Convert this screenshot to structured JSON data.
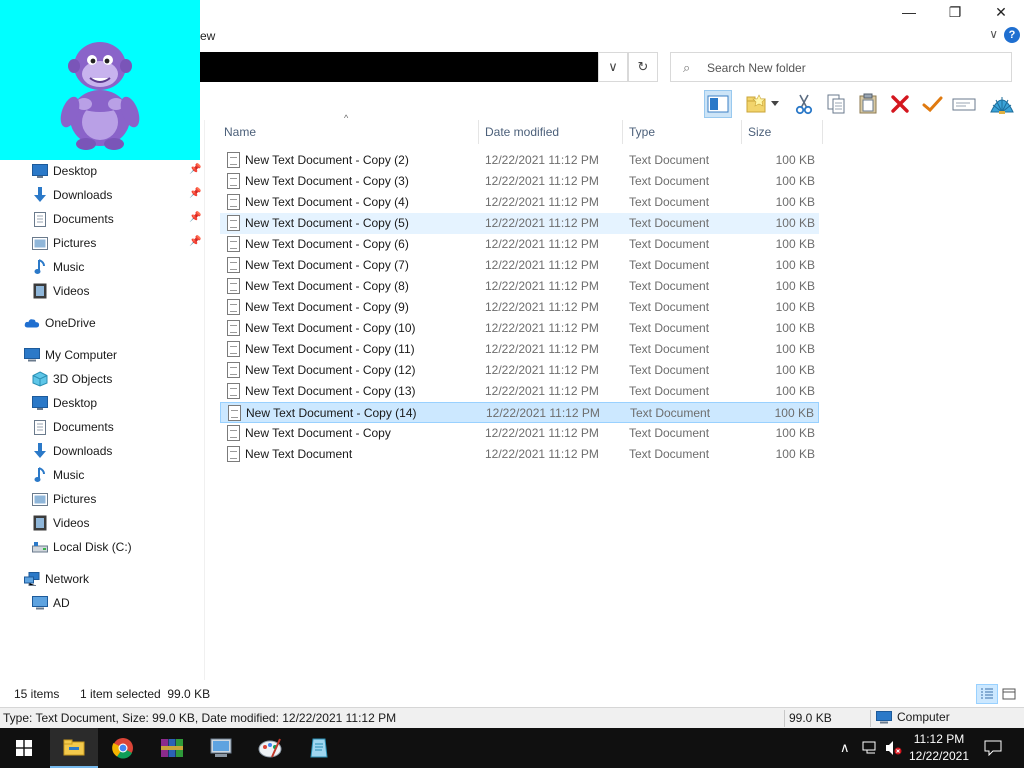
{
  "window": {
    "minimize_glyph": "—",
    "restore_glyph": "❐",
    "close_glyph": "✕",
    "ribbon_tab_partial": "ew",
    "help_glyph": "?",
    "ribbon_toggle_glyph": "∨"
  },
  "address": {
    "dropdown_glyph": "∨",
    "refresh_glyph": "↻"
  },
  "search": {
    "placeholder": "Search New folder",
    "icon": "search-icon"
  },
  "toolbar_icons": [
    "preview-pane-icon",
    "new-folder-icon",
    "dropdown-arrow-icon",
    "cut-icon",
    "copy-icon",
    "paste-icon",
    "delete-icon",
    "check-icon",
    "rename-icon",
    "shell-icon"
  ],
  "nav": {
    "quick_access": [
      {
        "label": "Desktop",
        "icon": "desktop-icon"
      },
      {
        "label": "Downloads",
        "icon": "downloads-icon"
      },
      {
        "label": "Documents",
        "icon": "documents-icon"
      },
      {
        "label": "Pictures",
        "icon": "pictures-icon"
      },
      {
        "label": "Music",
        "icon": "music-icon"
      },
      {
        "label": "Videos",
        "icon": "videos-icon"
      }
    ],
    "onedrive": "OneDrive",
    "computer": "My Computer",
    "computer_items": [
      {
        "label": "3D Objects",
        "icon": "3d-objects-icon"
      },
      {
        "label": "Desktop",
        "icon": "desktop-icon"
      },
      {
        "label": "Documents",
        "icon": "documents-icon"
      },
      {
        "label": "Downloads",
        "icon": "downloads-icon"
      },
      {
        "label": "Music",
        "icon": "music-icon"
      },
      {
        "label": "Pictures",
        "icon": "pictures-icon"
      },
      {
        "label": "Videos",
        "icon": "videos-icon"
      },
      {
        "label": "Local Disk (C:)",
        "icon": "local-disk-icon"
      }
    ],
    "network": "Network",
    "network_items": [
      {
        "label": "AD",
        "icon": "computer-icon"
      }
    ],
    "pin_glyph": "📌"
  },
  "columns": {
    "name": "Name",
    "date": "Date modified",
    "type": "Type",
    "size": "Size",
    "sort_glyph": "^"
  },
  "files": [
    {
      "name": "New Text Document - Copy (2)",
      "date": "12/22/2021 11:12 PM",
      "type": "Text Document",
      "size": "100 KB",
      "state": ""
    },
    {
      "name": "New Text Document - Copy (3)",
      "date": "12/22/2021 11:12 PM",
      "type": "Text Document",
      "size": "100 KB",
      "state": ""
    },
    {
      "name": "New Text Document - Copy (4)",
      "date": "12/22/2021 11:12 PM",
      "type": "Text Document",
      "size": "100 KB",
      "state": ""
    },
    {
      "name": "New Text Document - Copy (5)",
      "date": "12/22/2021 11:12 PM",
      "type": "Text Document",
      "size": "100 KB",
      "state": "hover"
    },
    {
      "name": "New Text Document - Copy (6)",
      "date": "12/22/2021 11:12 PM",
      "type": "Text Document",
      "size": "100 KB",
      "state": ""
    },
    {
      "name": "New Text Document - Copy (7)",
      "date": "12/22/2021 11:12 PM",
      "type": "Text Document",
      "size": "100 KB",
      "state": ""
    },
    {
      "name": "New Text Document - Copy (8)",
      "date": "12/22/2021 11:12 PM",
      "type": "Text Document",
      "size": "100 KB",
      "state": ""
    },
    {
      "name": "New Text Document - Copy (9)",
      "date": "12/22/2021 11:12 PM",
      "type": "Text Document",
      "size": "100 KB",
      "state": ""
    },
    {
      "name": "New Text Document - Copy (10)",
      "date": "12/22/2021 11:12 PM",
      "type": "Text Document",
      "size": "100 KB",
      "state": ""
    },
    {
      "name": "New Text Document - Copy (11)",
      "date": "12/22/2021 11:12 PM",
      "type": "Text Document",
      "size": "100 KB",
      "state": ""
    },
    {
      "name": "New Text Document - Copy (12)",
      "date": "12/22/2021 11:12 PM",
      "type": "Text Document",
      "size": "100 KB",
      "state": ""
    },
    {
      "name": "New Text Document - Copy (13)",
      "date": "12/22/2021 11:12 PM",
      "type": "Text Document",
      "size": "100 KB",
      "state": ""
    },
    {
      "name": "New Text Document - Copy (14)",
      "date": "12/22/2021 11:12 PM",
      "type": "Text Document",
      "size": "100 KB",
      "state": "selected"
    },
    {
      "name": "New Text Document - Copy",
      "date": "12/22/2021 11:12 PM",
      "type": "Text Document",
      "size": "100 KB",
      "state": ""
    },
    {
      "name": "New Text Document",
      "date": "12/22/2021 11:12 PM",
      "type": "Text Document",
      "size": "100 KB",
      "state": ""
    }
  ],
  "status": {
    "item_count": "15 items",
    "selection": "1 item selected  99.0 KB"
  },
  "details": {
    "info": "Type: Text Document, Size: 99.0 KB, Date modified: 12/22/2021 11:12 PM",
    "size": "99.0 KB",
    "location": "Computer"
  },
  "taskbar": {
    "apps": [
      "start-icon",
      "file-explorer-icon",
      "chrome-icon",
      "winrar-icon",
      "computer-app-icon",
      "paint-icon",
      "notepad-icon"
    ],
    "time": "11:12 PM",
    "date": "12/22/2021",
    "tray_chevron": "∧"
  },
  "colors": {
    "bonzi_bg": "#00ffff",
    "selected_bg": "#cce8ff",
    "hover_bg": "#e5f3ff",
    "taskbar": "#101010",
    "accent": "#1f6fd0"
  }
}
